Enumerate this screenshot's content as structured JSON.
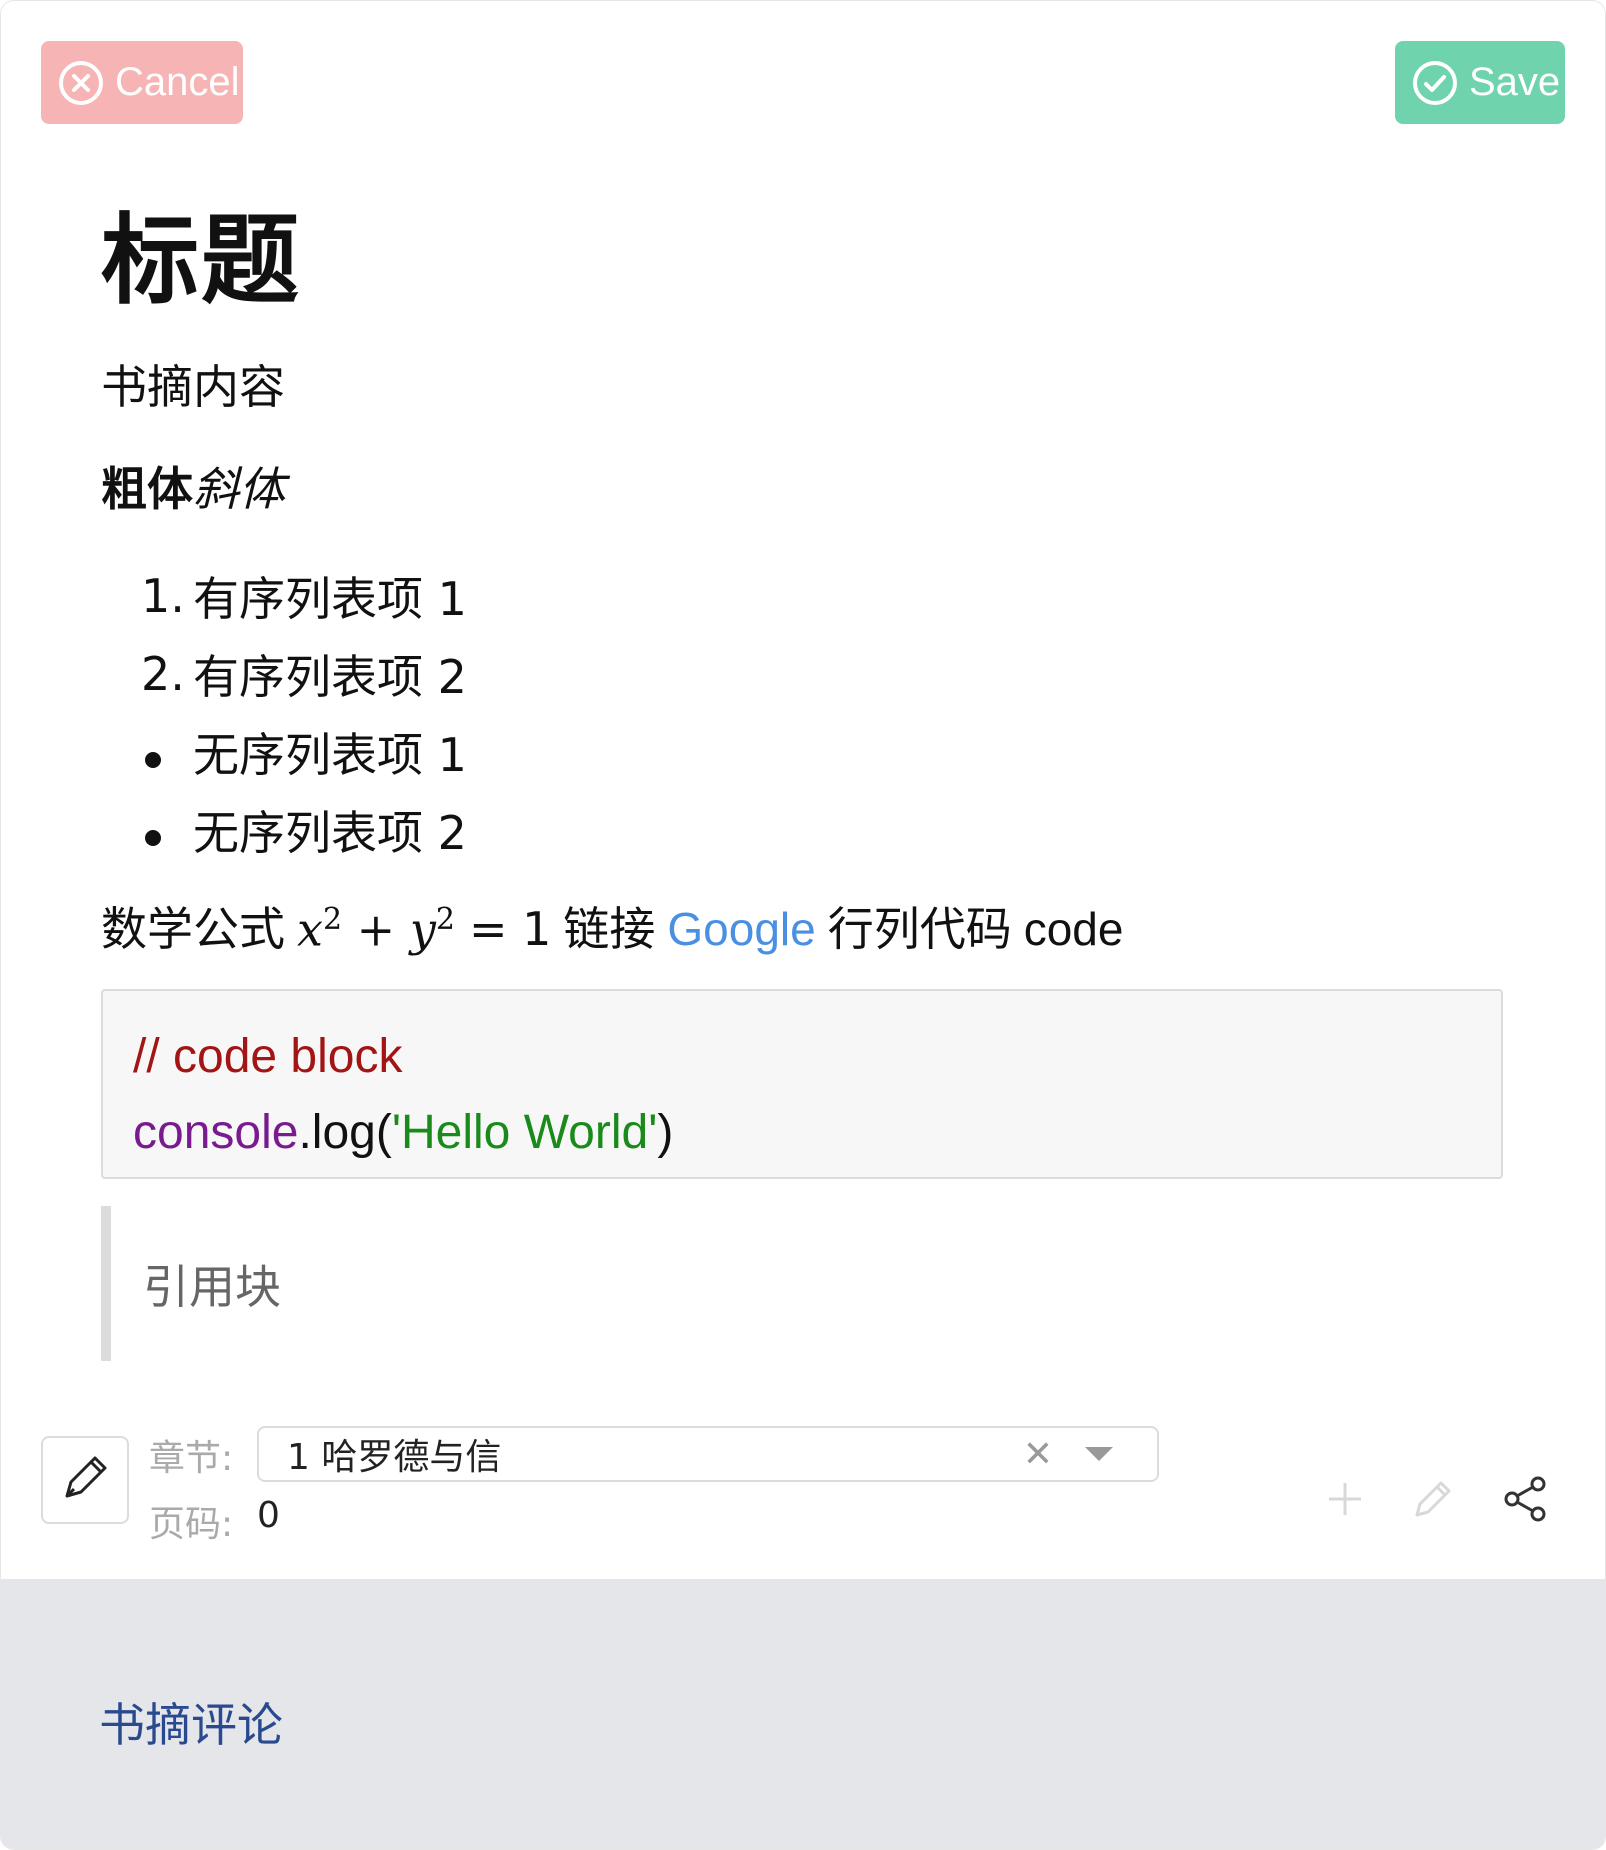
{
  "toolbar": {
    "cancel_label": "Cancel",
    "save_label": "Save",
    "cancel_color": "#f7b4b4",
    "save_color": "#6fd4ad",
    "cancel_icon": "circle-x-icon",
    "save_icon": "circle-check-icon"
  },
  "note": {
    "title": "标题",
    "paragraph": "书摘内容",
    "bold_text": "粗体",
    "italic_text": "斜体",
    "ordered_items": [
      {
        "marker": "1.",
        "text": "有序列表项 1"
      },
      {
        "marker": "2.",
        "text": "有序列表项 2"
      }
    ],
    "unordered_items": [
      {
        "text": "无序列表项 1"
      },
      {
        "text": "无序列表项 2"
      }
    ],
    "inline_line": {
      "math_prefix": "数学公式",
      "x": "x",
      "x_exp": "2",
      "plus": "+",
      "y": "y",
      "y_exp": "2",
      "equals": "= 1",
      "link_prefix": "链接",
      "link_text": "Google",
      "code_prefix": "行列代码",
      "code_text": "code"
    },
    "code_block": {
      "comment": "// code block",
      "object": "console",
      "call": ".log(",
      "string": "'Hello World'",
      "close": ")"
    },
    "quote": "引用块"
  },
  "meta": {
    "chapter_label": "章节:",
    "chapter_value": "1 哈罗德与信",
    "page_label": "页码:",
    "page_value": "0"
  },
  "actions": {
    "add_icon": "plus-icon",
    "edit_icon": "pencil-icon",
    "share_icon": "share-icon"
  },
  "footer": {
    "comment_link": "书摘评论",
    "background": "#e5e6ea"
  }
}
